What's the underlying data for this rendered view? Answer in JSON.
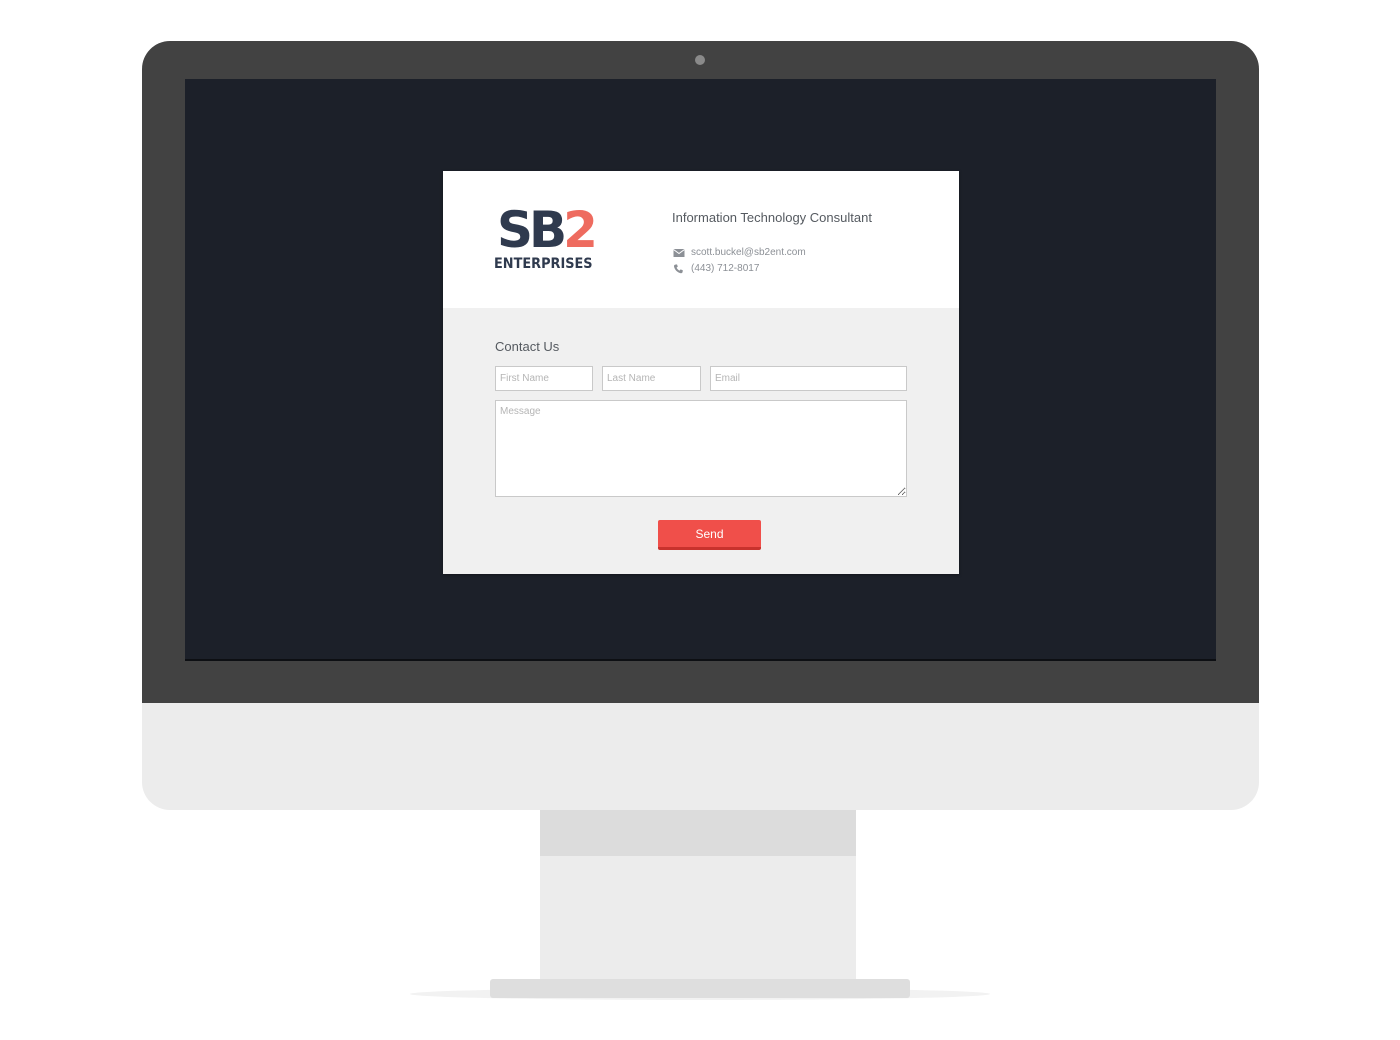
{
  "header": {
    "logo": {
      "primary": "SB",
      "accent": "2",
      "secondary": "ENTERPRISES"
    },
    "tagline": "Information Technology Consultant",
    "email": "scott.buckel@sb2ent.com",
    "phone": "(443) 712-8017",
    "icons": {
      "email": "envelope-icon",
      "phone": "phone-icon"
    }
  },
  "form": {
    "title": "Contact Us",
    "first_name_placeholder": "First Name",
    "last_name_placeholder": "Last Name",
    "email_placeholder": "Email",
    "message_placeholder": "Message",
    "send_label": "Send"
  },
  "colors": {
    "screen_background": "#1c2029",
    "accent": "#f04f4a",
    "logo_dark": "#2f3a4e",
    "logo_accent": "#ee6b5f",
    "bezel": "#424242"
  }
}
